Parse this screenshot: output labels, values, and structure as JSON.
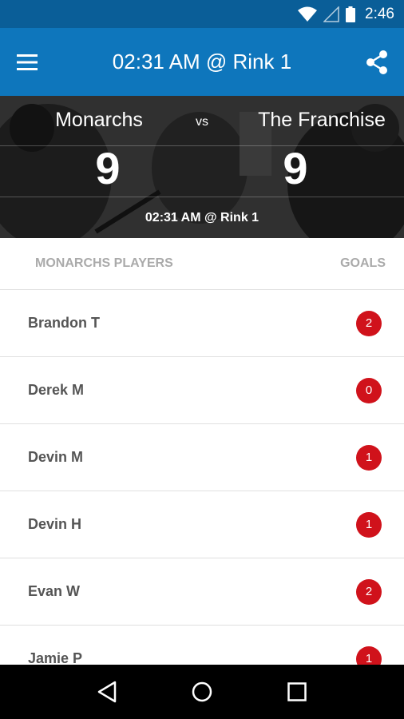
{
  "status_bar": {
    "time": "2:46",
    "icons": [
      "wifi-icon",
      "signal-icon",
      "battery-icon"
    ]
  },
  "app_bar": {
    "title": "02:31 AM @ Rink 1",
    "menu_icon": "menu-icon",
    "share_icon": "share-icon"
  },
  "game": {
    "home_team": "Monarchs",
    "away_team": "The Franchise",
    "vs_label": "vs",
    "home_score": "9",
    "away_score": "9",
    "time_location": "02:31 AM @ Rink 1"
  },
  "list": {
    "header_players": "MONARCHS PLAYERS",
    "header_goals": "GOALS",
    "players": [
      {
        "name": "Brandon T",
        "goals": "2"
      },
      {
        "name": "Derek M",
        "goals": "0"
      },
      {
        "name": "Devin M",
        "goals": "1"
      },
      {
        "name": "Devin H",
        "goals": "1"
      },
      {
        "name": "Evan W",
        "goals": "2"
      },
      {
        "name": "Jamie P",
        "goals": "1"
      }
    ]
  },
  "colors": {
    "status_bar": "#0a5e98",
    "app_bar": "#0e76bc",
    "badge": "#d0121b"
  },
  "nav_bar": {
    "icons": [
      "back-icon",
      "home-icon",
      "recents-icon"
    ]
  }
}
